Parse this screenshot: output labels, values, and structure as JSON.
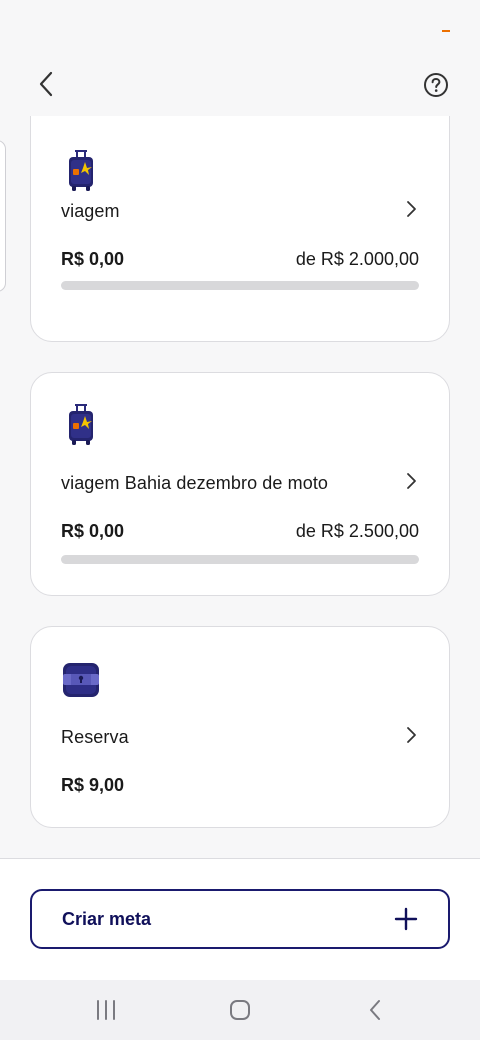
{
  "colors": {
    "brand_navy": "#1a1a6e",
    "accent_orange": "#ec7000",
    "progress_track": "#d8d8da",
    "card_border": "#dcdce0"
  },
  "header": {
    "back_icon": "chevron-left-icon",
    "help_icon": "question-circle-icon"
  },
  "goals": [
    {
      "icon": "suitcase-icon",
      "name": "viagem",
      "amount": "R$ 0,00",
      "target": "de R$ 2.000,00",
      "progress": 0
    },
    {
      "icon": "suitcase-icon",
      "name": "viagem Bahia dezembro de moto",
      "amount": "R$ 0,00",
      "target": "de R$ 2.500,00",
      "progress": 0
    },
    {
      "icon": "safe-icon",
      "name": "Reserva",
      "amount": "R$ 9,00"
    }
  ],
  "create_goal": {
    "label": "Criar meta",
    "icon": "plus-icon"
  },
  "nav_bar": {
    "recents_icon": "recents-icon",
    "home_icon": "home-icon",
    "back_icon": "back-icon"
  }
}
